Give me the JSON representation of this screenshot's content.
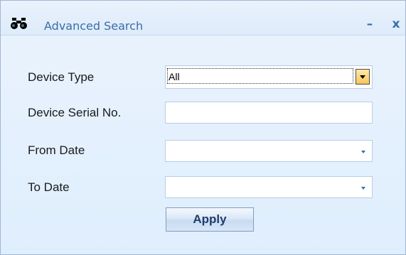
{
  "window": {
    "title": "Advanced Search",
    "title_icon": "binoculars-icon",
    "minimize_label": "–",
    "close_label": "x"
  },
  "form": {
    "device_type": {
      "label": "Device Type",
      "value": "All"
    },
    "device_serial": {
      "label": "Device Serial No.",
      "value": ""
    },
    "from_date": {
      "label": "From Date",
      "value": ""
    },
    "to_date": {
      "label": "To Date",
      "value": ""
    },
    "apply_label": "Apply"
  },
  "colors": {
    "title_text": "#3b6da8",
    "background": "#e4f0fd",
    "combo_button": "#f8c65d"
  }
}
